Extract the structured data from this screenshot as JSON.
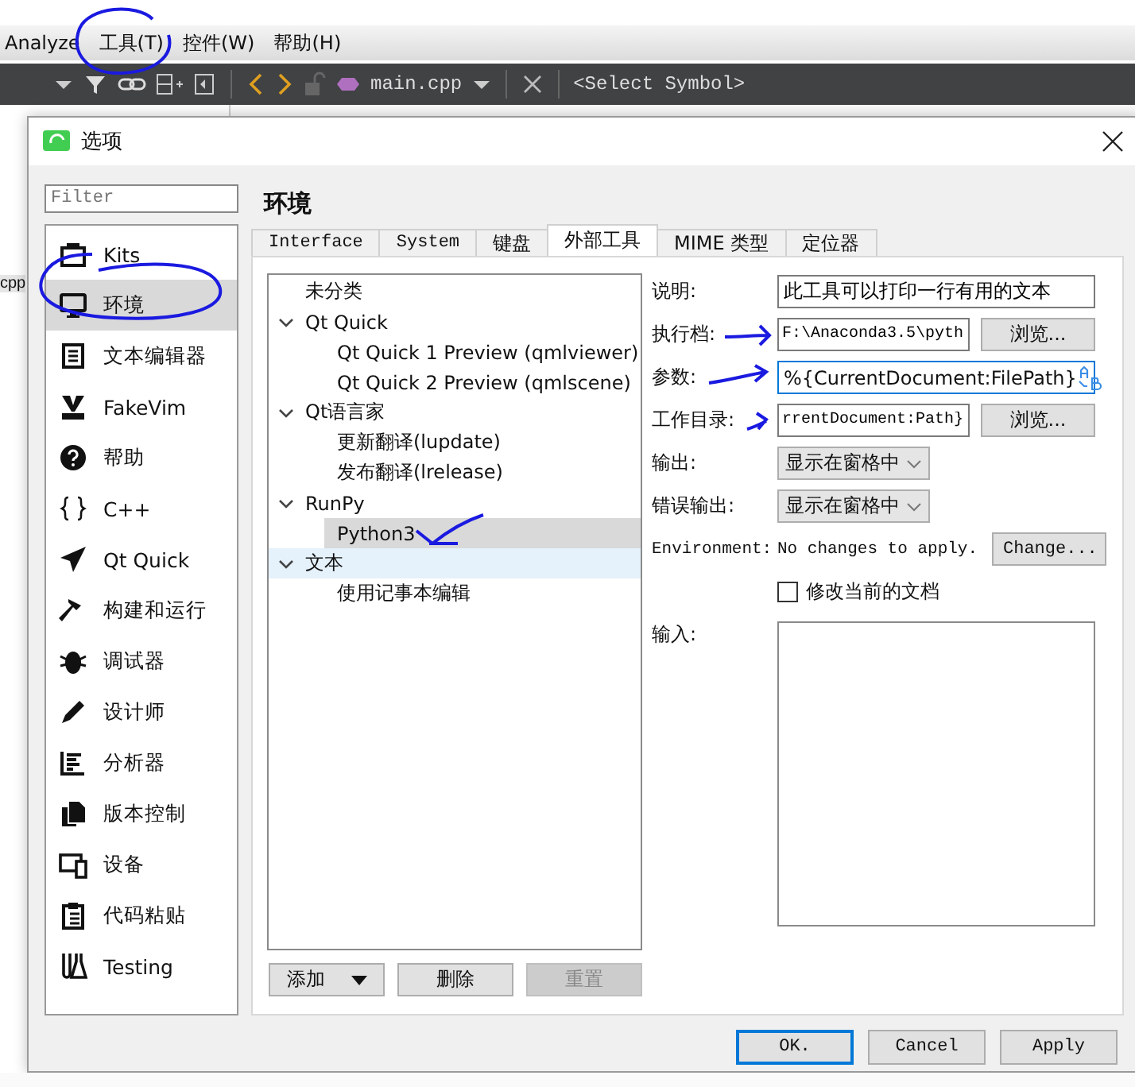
{
  "menu_bar": {
    "items": [
      "Analyze",
      "工具(T)",
      "控件(W)",
      "帮助(H)"
    ]
  },
  "editor_toolbar": {
    "file": "main.cpp",
    "symbol": "<Select Symbol>"
  },
  "background_panel": {
    "text": "cpp"
  },
  "dialog": {
    "title": "选项",
    "filter": {
      "placeholder": "Filter"
    },
    "categories": [
      {
        "label": "Kits",
        "selected": false
      },
      {
        "label": "环境",
        "selected": true
      },
      {
        "label": "文本编辑器",
        "selected": false
      },
      {
        "label": "FakeVim",
        "selected": false
      },
      {
        "label": "帮助",
        "selected": false
      },
      {
        "label": "C++",
        "selected": false
      },
      {
        "label": "Qt Quick",
        "selected": false
      },
      {
        "label": "构建和运行",
        "selected": false
      },
      {
        "label": "调试器",
        "selected": false
      },
      {
        "label": "设计师",
        "selected": false
      },
      {
        "label": "分析器",
        "selected": false
      },
      {
        "label": "版本控制",
        "selected": false
      },
      {
        "label": "设备",
        "selected": false
      },
      {
        "label": "代码粘贴",
        "selected": false
      },
      {
        "label": "Testing",
        "selected": false
      }
    ],
    "heading": "环境",
    "tabs": [
      {
        "label": "Interface",
        "selected": false
      },
      {
        "label": "System",
        "selected": false
      },
      {
        "label": "键盘",
        "selected": false
      },
      {
        "label": "外部工具",
        "selected": true
      },
      {
        "label": "MIME 类型",
        "selected": false
      },
      {
        "label": "定位器",
        "selected": false
      }
    ],
    "tree": [
      {
        "label": "未分类",
        "selected": false,
        "hovered": false
      },
      {
        "label": "Qt Quick",
        "expanded": true,
        "selected": false,
        "hovered": false,
        "children": [
          {
            "label": "Qt Quick 1 Preview (qmlviewer)",
            "selected": false,
            "hovered": false
          },
          {
            "label": "Qt Quick 2 Preview (qmlscene)",
            "selected": false,
            "hovered": false
          }
        ]
      },
      {
        "label": "Qt语言家",
        "expanded": true,
        "selected": false,
        "hovered": false,
        "children": [
          {
            "label": "更新翻译(lupdate)",
            "selected": false,
            "hovered": false
          },
          {
            "label": "发布翻译(lrelease)",
            "selected": false,
            "hovered": false
          }
        ]
      },
      {
        "label": "RunPy",
        "expanded": true,
        "selected": false,
        "hovered": false,
        "children": [
          {
            "label": "Python3",
            "selected": true,
            "hovered": false
          }
        ]
      },
      {
        "label": "文本",
        "expanded": true,
        "selected": false,
        "hovered": true,
        "children": [
          {
            "label": "使用记事本编辑",
            "selected": false,
            "hovered": false
          }
        ]
      }
    ],
    "tree_buttons": [
      {
        "label": "添加",
        "kind": "dropdown",
        "disabled": false
      },
      {
        "label": "删除",
        "kind": "plain",
        "disabled": false
      },
      {
        "label": "重置",
        "kind": "plain",
        "disabled": true
      }
    ],
    "form": [
      {
        "kind": "text",
        "label": "说明:",
        "value": "此工具可以打印一行有用的文本"
      },
      {
        "kind": "path",
        "label": "执行档:",
        "value": "F:\\Anaconda3.5\\pyth",
        "button": "浏览..."
      },
      {
        "kind": "args",
        "label": "参数:",
        "value": "%{CurrentDocument:FilePath}",
        "focused": true
      },
      {
        "kind": "path",
        "label": "工作目录:",
        "value": "rrentDocument:Path}",
        "button": "浏览..."
      },
      {
        "kind": "select",
        "label": "输出:",
        "value": "显示在窗格中"
      },
      {
        "kind": "select",
        "label": "错误输出:",
        "value": "显示在窗格中"
      },
      {
        "kind": "environment",
        "label": "Environment:",
        "value": "No changes to apply.",
        "button": "Change..."
      },
      {
        "kind": "checkbox",
        "label": "修改当前的文档",
        "checked": false
      },
      {
        "kind": "textarea",
        "label": "输入:"
      }
    ],
    "buttons": [
      {
        "label": "OK.",
        "focused": true
      },
      {
        "label": "Cancel",
        "focused": false
      },
      {
        "label": "Apply",
        "focused": false
      }
    ]
  }
}
